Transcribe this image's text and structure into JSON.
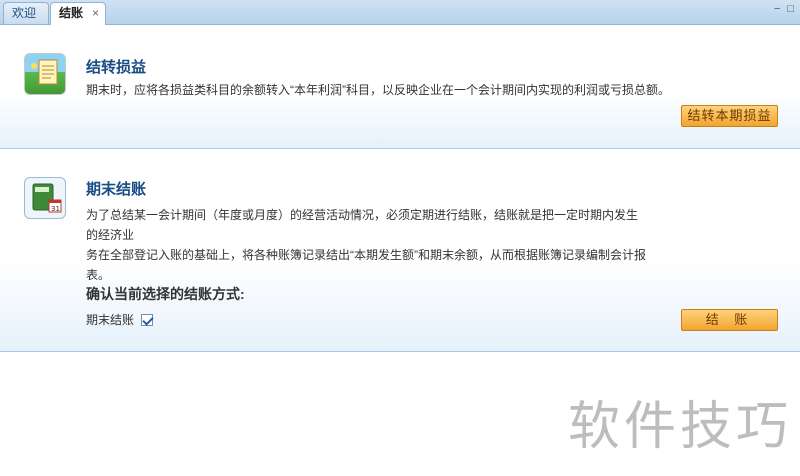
{
  "tabs": [
    {
      "label": "欢迎",
      "active": false
    },
    {
      "label": "结账",
      "active": true,
      "close": "×"
    }
  ],
  "window_buttons": "− □",
  "section1": {
    "title": "结转损益",
    "description": "期末时，应将各损益类科目的余额转入“本年利润”科目，以反映企业在一个会计期间内实现的利润或亏损总额。",
    "button_label": "结转本期损益",
    "icon": "calendar-notes-icon"
  },
  "section2": {
    "title": "期末结账",
    "description_line1": "为了总结某一会计期间（年度或月度）的经营活动情况，必须定期进行结账，结账就是把一定时期内发生的经济业",
    "description_line2": "务在全部登记入账的基础上，将各种账簿记录结出“本期发生额”和期末余额，从而根据账簿记录编制会计报表。",
    "confirm_label": "确认当前选择的结账方式:",
    "checkbox_label": "期末结账",
    "checkbox_checked": true,
    "button_label": "结 账",
    "icon": "ledger-book-icon"
  },
  "watermark": "软件技巧",
  "colors": {
    "accent": "#1a4c86",
    "button": "#f3a431",
    "border": "#a9c8e6"
  }
}
